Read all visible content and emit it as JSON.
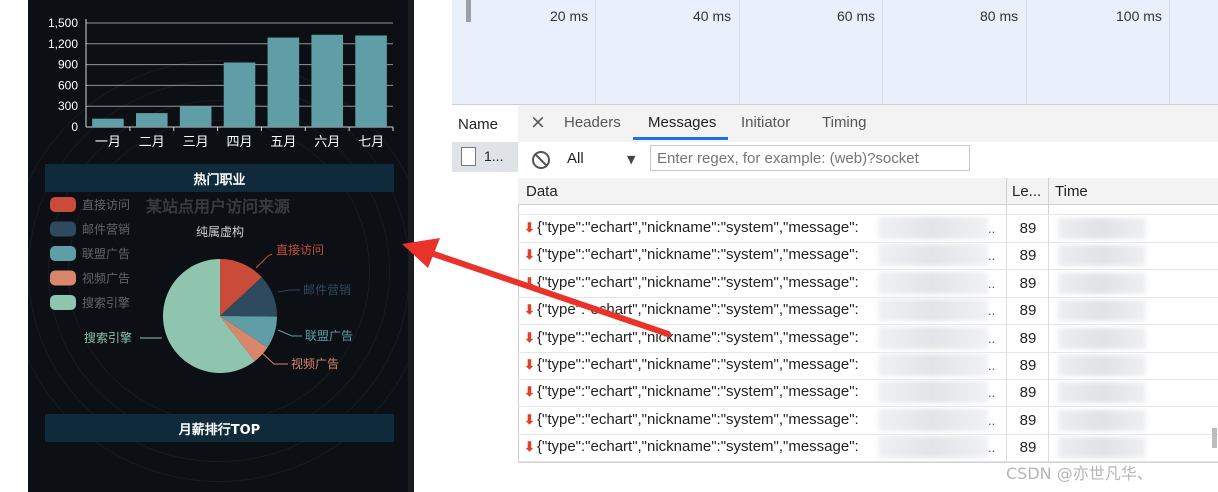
{
  "phone": {
    "bar_chart": {
      "y_ticks": [
        "1,500",
        "1,200",
        "900",
        "600",
        "300",
        "0"
      ],
      "categories": [
        "一月",
        "二月",
        "三月",
        "四月",
        "五月",
        "六月",
        "七月"
      ],
      "bar_color": "#5f9ea6"
    },
    "section_hot_jobs": "热门职业",
    "pie_title": "某站点用户访问来源",
    "pie_subtitle": "纯属虚构",
    "legend": [
      "直接访问",
      "邮件营销",
      "联盟广告",
      "视频广告",
      "搜索引擎"
    ],
    "legend_colors": [
      "#c94b3a",
      "#2e4a5e",
      "#5f9ea6",
      "#d9876a",
      "#8fc4ae"
    ],
    "pie_labels": {
      "direct": "直接访问",
      "email": "邮件营销",
      "union": "联盟广告",
      "video": "视频广告",
      "search": "搜索引擎"
    },
    "section_salary": "月薪排行TOP"
  },
  "chart_data": [
    {
      "type": "bar",
      "categories": [
        "一月",
        "二月",
        "三月",
        "四月",
        "五月",
        "六月",
        "七月"
      ],
      "values": [
        120,
        200,
        300,
        930,
        1290,
        1330,
        1320
      ],
      "ylim": [
        0,
        1500
      ],
      "y_ticks": [
        0,
        300,
        600,
        900,
        1200,
        1500
      ],
      "title": "",
      "xlabel": "",
      "ylabel": ""
    },
    {
      "type": "pie",
      "title": "某站点用户访问来源",
      "subtitle": "纯属虚构",
      "categories": [
        "直接访问",
        "邮件营销",
        "联盟广告",
        "视频广告",
        "搜索引擎"
      ],
      "values": [
        335,
        310,
        234,
        135,
        1548
      ],
      "colors": [
        "#c94b3a",
        "#2e4a5e",
        "#5f9ea6",
        "#d9876a",
        "#8fc4ae"
      ],
      "legend": "top-left"
    }
  ],
  "timeline": {
    "labels": [
      "20 ms",
      "40 ms",
      "60 ms",
      "80 ms",
      "100 ms"
    ]
  },
  "devtools": {
    "name_header": "Name",
    "request_name": "1...",
    "close_glyph": "×",
    "tabs": [
      "Headers",
      "Messages",
      "Initiator",
      "Timing"
    ],
    "active_tab": "Messages",
    "filter_select": "All",
    "filter_placeholder": "Enter regex, for example: (web)?socket",
    "columns": {
      "data": "Data",
      "length": "Le...",
      "time": "Time"
    },
    "rows": [
      {
        "arrow": "⬇",
        "message": "{\"type\":\"echart\",\"nickname\":\"system\",\"message\":",
        "dots": "..",
        "length": "89"
      },
      {
        "arrow": "⬇",
        "message": "{\"type\":\"echart\",\"nickname\":\"system\",\"message\":",
        "dots": "..",
        "length": "89"
      },
      {
        "arrow": "⬇",
        "message": "{\"type\":\"echart\",\"nickname\":\"system\",\"message\":",
        "dots": "..",
        "length": "89"
      },
      {
        "arrow": "⬇",
        "message": "{\"type\":\"echart\",\"nickname\":\"system\",\"message\":",
        "dots": "..",
        "length": "89"
      },
      {
        "arrow": "⬇",
        "message": "{\"type\":\"echart\",\"nickname\":\"system\",\"message\":",
        "dots": "..",
        "length": "89"
      },
      {
        "arrow": "⬇",
        "message": "{\"type\":\"echart\",\"nickname\":\"system\",\"message\":",
        "dots": "..",
        "length": "89"
      },
      {
        "arrow": "⬇",
        "message": "{\"type\":\"echart\",\"nickname\":\"system\",\"message\":",
        "dots": "..",
        "length": "89"
      },
      {
        "arrow": "⬇",
        "message": "{\"type\":\"echart\",\"nickname\":\"system\",\"message\":",
        "dots": "..",
        "length": "89"
      },
      {
        "arrow": "⬇",
        "message": "{\"type\":\"echart\",\"nickname\":\"system\",\"message\":",
        "dots": "..",
        "length": "89"
      }
    ]
  },
  "watermark": "CSDN @亦世凡华、",
  "annotation_arrow_color": "#e8322a",
  "icons": {
    "block": "block-icon",
    "dropdown": "dropdown-caret-icon",
    "file": "file-icon",
    "close": "close-icon",
    "arrow": "download-arrow-icon"
  }
}
